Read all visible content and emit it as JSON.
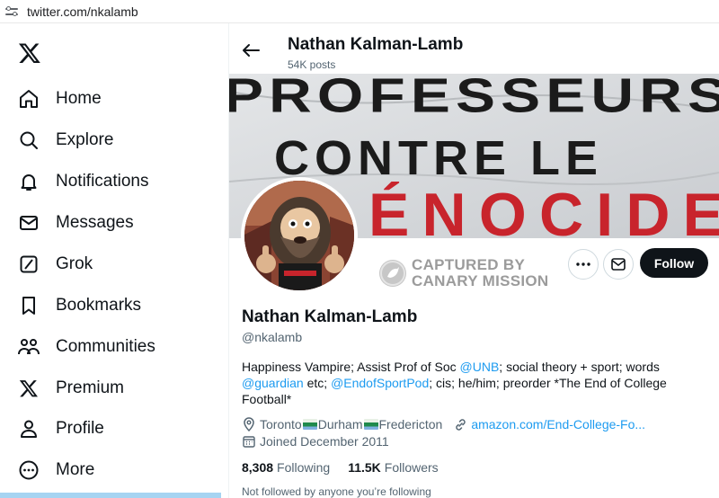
{
  "browser": {
    "url": "twitter.com/nkalamb"
  },
  "nav": {
    "items": [
      {
        "label": "Home",
        "icon": "home-icon"
      },
      {
        "label": "Explore",
        "icon": "search-icon"
      },
      {
        "label": "Notifications",
        "icon": "bell-icon"
      },
      {
        "label": "Messages",
        "icon": "envelope-icon"
      },
      {
        "label": "Grok",
        "icon": "grok-icon"
      },
      {
        "label": "Bookmarks",
        "icon": "bookmark-icon"
      },
      {
        "label": "Communities",
        "icon": "people-icon"
      },
      {
        "label": "Premium",
        "icon": "x-logo-icon"
      },
      {
        "label": "Profile",
        "icon": "person-icon"
      },
      {
        "label": "More",
        "icon": "more-circle-icon"
      }
    ]
  },
  "header": {
    "name": "Nathan Kalman-Lamb",
    "posts": "54K posts"
  },
  "banner": {
    "line1": "PROFESSEURS",
    "line2": "CONTRE LE",
    "line3": "ÉNOCIDE"
  },
  "watermark": {
    "line1": "CAPTURED BY",
    "line2": "CANARY MISSION"
  },
  "actions": {
    "follow": "Follow"
  },
  "profile": {
    "name": "Nathan Kalman-Lamb",
    "handle": "@nkalamb",
    "bio": {
      "t1": "Happiness Vampire; Assist Prof of Soc ",
      "l1": "@UNB",
      "t2": "; social theory + sport; words ",
      "l2": "@guardian",
      "t3": " etc; ",
      "l3": "@EndofSportPod",
      "t4": "; cis; he/him; preorder *The End of College Football*"
    },
    "location": {
      "a": "Toronto ",
      "b": "Durham",
      "c": "Fredericton"
    },
    "website": "amazon.com/End-College-Fo...",
    "joined": "Joined December 2011",
    "following_count": "8,308",
    "following_label": "Following",
    "followers_count": "11.5K",
    "followers_label": "Followers",
    "not_followed": "Not followed by anyone you’re following"
  },
  "colors": {
    "accent": "#1d9bf0",
    "text": "#0f1419",
    "muted": "#536471",
    "banner_red": "#c8242c"
  }
}
